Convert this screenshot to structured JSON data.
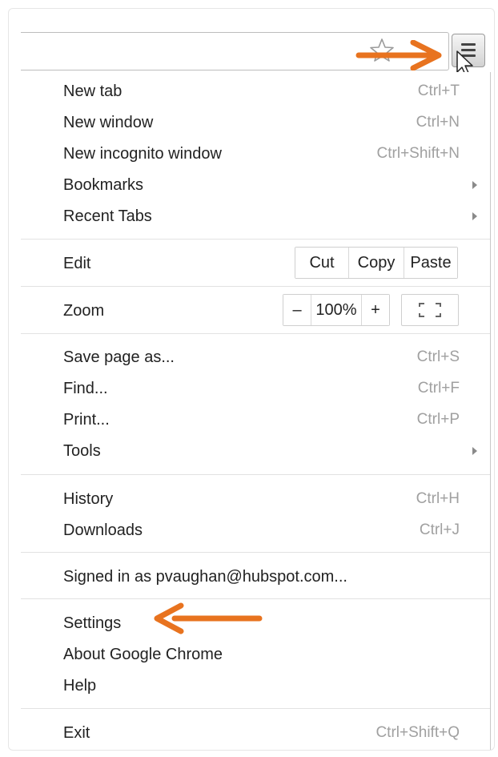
{
  "colors": {
    "accent_arrow": "#e8731f",
    "shortcut_text": "#a0a0a0",
    "separator": "#e2e2e2"
  },
  "icons": {
    "bookmark": "star-icon",
    "menu": "hamburger-icon",
    "pointer": "mouse-cursor-icon",
    "fullscreen": "fullscreen-icon"
  },
  "menu": {
    "new_tab": {
      "label": "New tab",
      "shortcut": "Ctrl+T"
    },
    "new_window": {
      "label": "New window",
      "shortcut": "Ctrl+N"
    },
    "new_incognito": {
      "label": "New incognito window",
      "shortcut": "Ctrl+Shift+N"
    },
    "bookmarks": {
      "label": "Bookmarks"
    },
    "recent_tabs": {
      "label": "Recent Tabs"
    },
    "edit": {
      "label": "Edit",
      "cut": "Cut",
      "copy": "Copy",
      "paste": "Paste"
    },
    "zoom": {
      "label": "Zoom",
      "minus": "–",
      "value": "100%",
      "plus": "+"
    },
    "save_page": {
      "label": "Save page as...",
      "shortcut": "Ctrl+S"
    },
    "find": {
      "label": "Find...",
      "shortcut": "Ctrl+F"
    },
    "print": {
      "label": "Print...",
      "shortcut": "Ctrl+P"
    },
    "tools": {
      "label": "Tools"
    },
    "history": {
      "label": "History",
      "shortcut": "Ctrl+H"
    },
    "downloads": {
      "label": "Downloads",
      "shortcut": "Ctrl+J"
    },
    "signed_in": {
      "label": "Signed in as pvaughan@hubspot.com..."
    },
    "settings": {
      "label": "Settings"
    },
    "about": {
      "label": "About Google Chrome"
    },
    "help": {
      "label": "Help"
    },
    "exit": {
      "label": "Exit",
      "shortcut": "Ctrl+Shift+Q"
    }
  }
}
